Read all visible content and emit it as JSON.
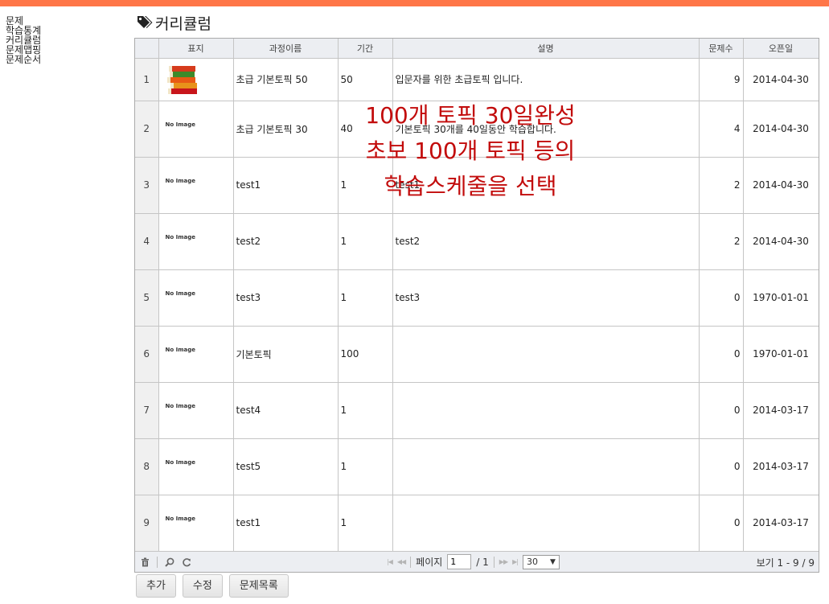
{
  "sidebar": {
    "items": [
      {
        "label": "문제"
      },
      {
        "label": "학습통계"
      },
      {
        "label": "커리큘럼"
      },
      {
        "label": "문제맵핑"
      },
      {
        "label": "문제순서"
      }
    ]
  },
  "header": {
    "title": "커리큘럼",
    "icon": "tags-icon"
  },
  "grid": {
    "columns": [
      "표지",
      "과정이름",
      "기간",
      "설명",
      "문제수",
      "오픈일"
    ],
    "rows": [
      {
        "num": "1",
        "image": "book-stack",
        "name": "초급 기본토픽 50",
        "period": "50",
        "desc": "입문자를 위한 초급토픽 입니다.",
        "count": "9",
        "open": "2014-04-30"
      },
      {
        "num": "2",
        "image": "No Image",
        "name": "초급 기본토픽 30",
        "period": "40",
        "desc": "기본토픽 30개를 40일동안 학습합니다.",
        "count": "4",
        "open": "2014-04-30"
      },
      {
        "num": "3",
        "image": "No Image",
        "name": "test1",
        "period": "1",
        "desc": "test1",
        "count": "2",
        "open": "2014-04-30"
      },
      {
        "num": "4",
        "image": "No Image",
        "name": "test2",
        "period": "1",
        "desc": "test2",
        "count": "2",
        "open": "2014-04-30"
      },
      {
        "num": "5",
        "image": "No Image",
        "name": "test3",
        "period": "1",
        "desc": "test3",
        "count": "0",
        "open": "1970-01-01"
      },
      {
        "num": "6",
        "image": "No Image",
        "name": "기본토픽",
        "period": "100",
        "desc": "",
        "count": "0",
        "open": "1970-01-01"
      },
      {
        "num": "7",
        "image": "No Image",
        "name": "test4",
        "period": "1",
        "desc": "",
        "count": "0",
        "open": "2014-03-17"
      },
      {
        "num": "8",
        "image": "No Image",
        "name": "test5",
        "period": "1",
        "desc": "",
        "count": "0",
        "open": "2014-03-17"
      },
      {
        "num": "9",
        "image": "No Image",
        "name": "test1",
        "period": "1",
        "desc": "",
        "count": "0",
        "open": "2014-03-17"
      }
    ]
  },
  "pager": {
    "page_label": "페이지",
    "page_value": "1",
    "total_pages": "/ 1",
    "page_size": "30",
    "view_text": "보기 1 - 9 / 9"
  },
  "overlay": {
    "lines": [
      "100개 토픽 30일완성",
      "초보 100개 토픽 등의",
      "학습스케줄을 선택"
    ],
    "color": "#c20b0b"
  },
  "buttons": {
    "add": "추가",
    "edit": "수정",
    "problem_list": "문제목록"
  },
  "colors": {
    "topbar": "#ff7648",
    "header_bg": "#eceef2"
  }
}
